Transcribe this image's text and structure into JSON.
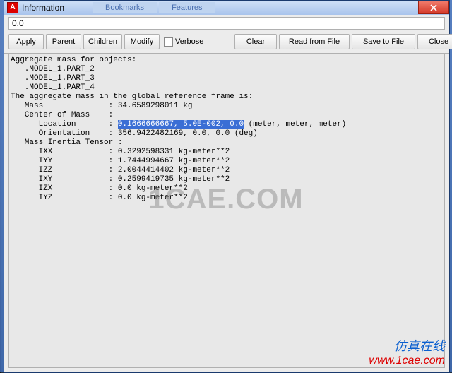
{
  "window": {
    "title": "Information",
    "tabs": [
      "Bookmarks",
      "Features"
    ],
    "input_value": "0.0"
  },
  "toolbar": {
    "apply": "Apply",
    "parent": "Parent",
    "children": "Children",
    "modify": "Modify",
    "verbose": "Verbose",
    "clear": "Clear",
    "read": "Read from File",
    "save": "Save to File",
    "close": "Close"
  },
  "text": {
    "l1": "Aggregate mass for objects:",
    "l2": "   .MODEL_1.PART_2",
    "l3": "   .MODEL_1.PART_3",
    "l4": "   .MODEL_1.PART_4",
    "l5": "The aggregate mass in the global reference frame is:",
    "l6": "   Mass              : 34.6589298011 kg",
    "l7": "   Center of Mass    :",
    "l8a": "      Location       : ",
    "l8_sel": "0.1666666667, 5.0E-002, 0.0",
    "l8b": " (meter, meter, meter)",
    "l9": "      Orientation    : 356.9422482169, 0.0, 0.0 (deg)",
    "l10": "   Mass Inertia Tensor :",
    "l11": "      IXX            : 0.3292598331 kg-meter**2",
    "l12": "      IYY            : 1.7444994667 kg-meter**2",
    "l13": "      IZZ            : 2.0044414402 kg-meter**2",
    "l14": "      IXY            : 0.2599419735 kg-meter**2",
    "l15": "      IZX            : 0.0 kg-meter**2",
    "l16": "      IYZ            : 0.0 kg-meter**2"
  },
  "watermark": "1CAE.COM",
  "footer": {
    "cn": "仿真在线",
    "url": "www.1cae.com"
  }
}
